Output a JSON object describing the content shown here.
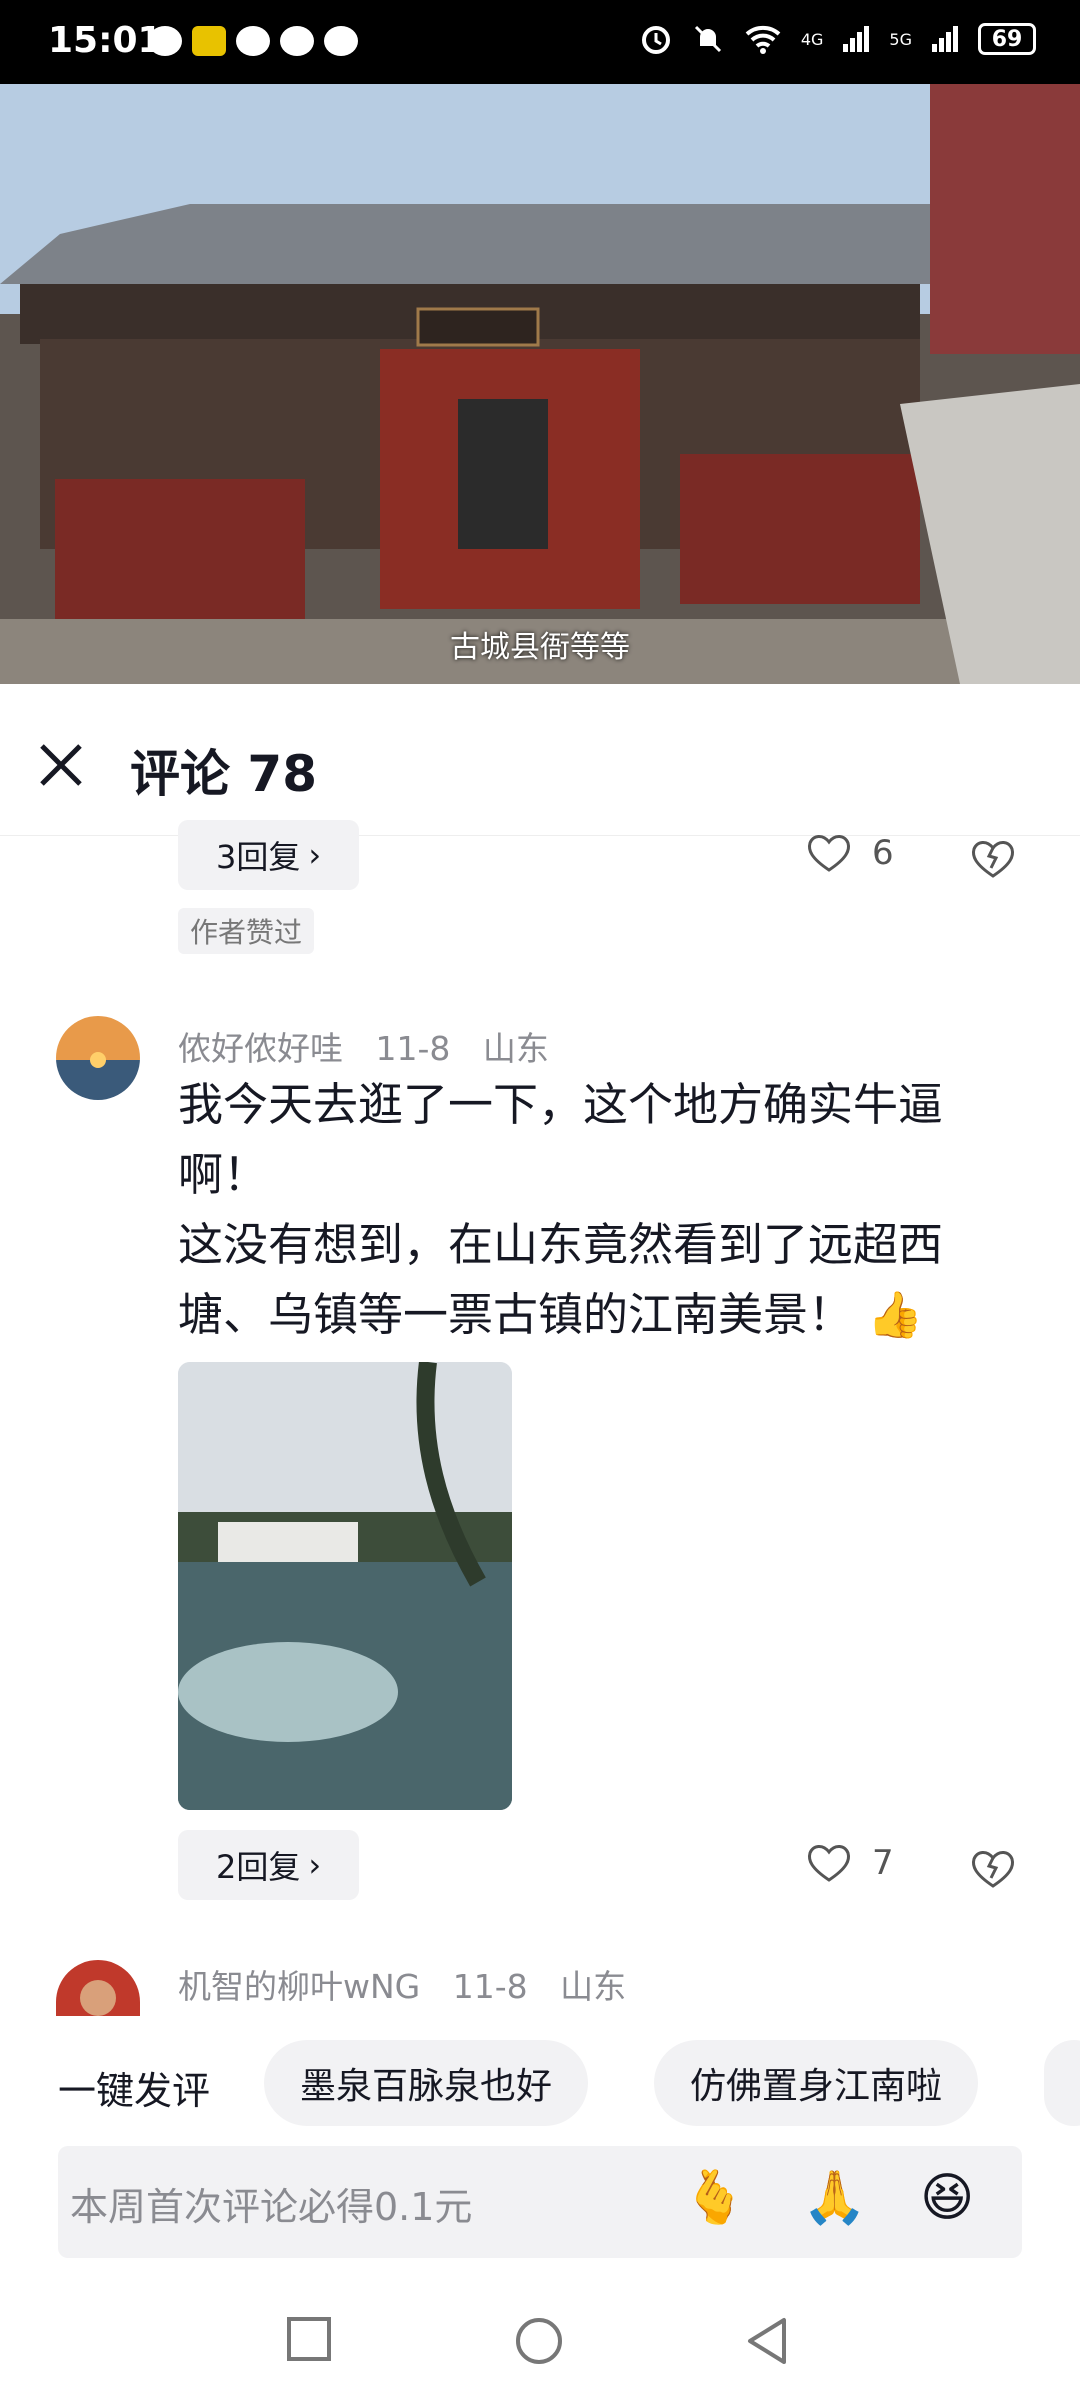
{
  "status_bar": {
    "time": "15:01",
    "battery": "69",
    "signal_labels": [
      "4G",
      "5G"
    ]
  },
  "video": {
    "subtitle": "古城县衙等等"
  },
  "comments_panel": {
    "title": "评论 78",
    "prev_comment": {
      "reply_label": "3回复",
      "like_count": "6",
      "author_liked_badge": "作者赞过"
    },
    "comment": {
      "username": "侬好侬好哇",
      "date": "11-8",
      "location": "山东",
      "text_line1": "我今天去逛了一下，这个地方确实牛逼啊！",
      "text_line2": "这没有想到，在山东竟然看到了远超西塘、乌镇等一票古镇的江南美景！",
      "emoji": "👍",
      "reply_label": "2回复",
      "like_count": "7"
    },
    "next_comment": {
      "username": "机智的柳叶wNG",
      "date": "11-8",
      "location": "山东"
    }
  },
  "quick_reply": {
    "label": "一键发评",
    "chips": [
      "墨泉百脉泉也好",
      "仿佛置身江南啦"
    ]
  },
  "input": {
    "placeholder": "本周首次评论必得0.1元",
    "emojis": [
      "🫰",
      "🙏",
      "😆"
    ]
  },
  "colors": {
    "text_primary": "#161823",
    "text_secondary": "#8a8b91",
    "chip_bg": "#f2f2f4"
  }
}
